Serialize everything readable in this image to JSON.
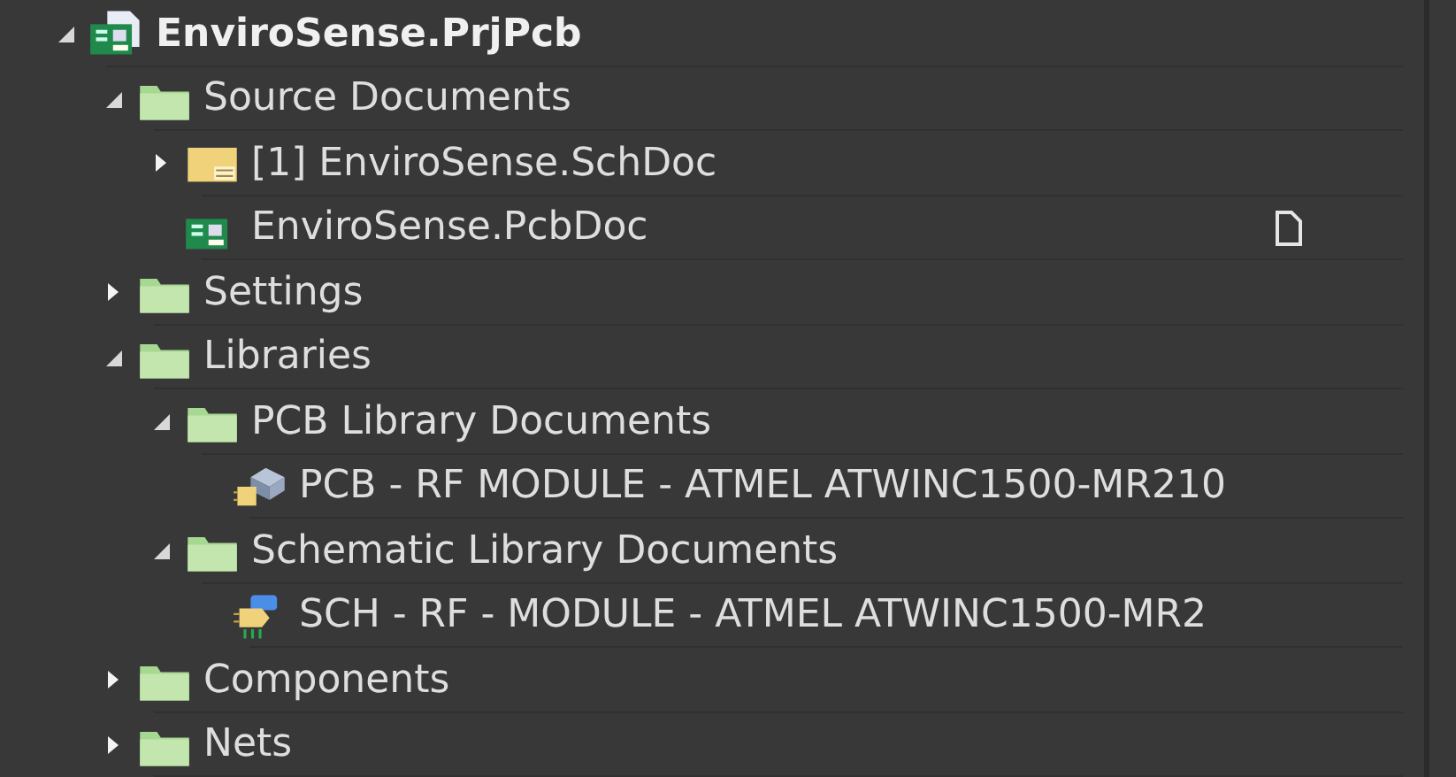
{
  "tree": [
    {
      "label": "EnviroSense.PrjPcb",
      "kind": "project",
      "expanded": true,
      "marked": false,
      "children": [
        {
          "label": "Source Documents",
          "kind": "folder",
          "expanded": true,
          "marked": false,
          "children": [
            {
              "label": "[1] EnviroSense.SchDoc",
              "kind": "schdoc",
              "expanded": false,
              "marked": false
            },
            {
              "label": "EnviroSense.PcbDoc",
              "kind": "pcbdoc",
              "marked": true
            }
          ]
        },
        {
          "label": "Settings",
          "kind": "folder",
          "expanded": false,
          "marked": false
        },
        {
          "label": "Libraries",
          "kind": "folder",
          "expanded": true,
          "marked": false,
          "children": [
            {
              "label": "PCB Library Documents",
              "kind": "folder",
              "expanded": true,
              "marked": false,
              "children": [
                {
                  "label": "PCB - RF MODULE - ATMEL ATWINC1500-MR210",
                  "kind": "pcblib",
                  "marked": false
                }
              ]
            },
            {
              "label": "Schematic Library Documents",
              "kind": "folder",
              "expanded": true,
              "marked": false,
              "children": [
                {
                  "label": "SCH - RF - MODULE - ATMEL ATWINC1500-MR2",
                  "kind": "schlib",
                  "marked": false
                }
              ]
            }
          ]
        },
        {
          "label": "Components",
          "kind": "folder",
          "expanded": false,
          "marked": false
        },
        {
          "label": "Nets",
          "kind": "folder",
          "expanded": false,
          "marked": false
        }
      ]
    }
  ]
}
